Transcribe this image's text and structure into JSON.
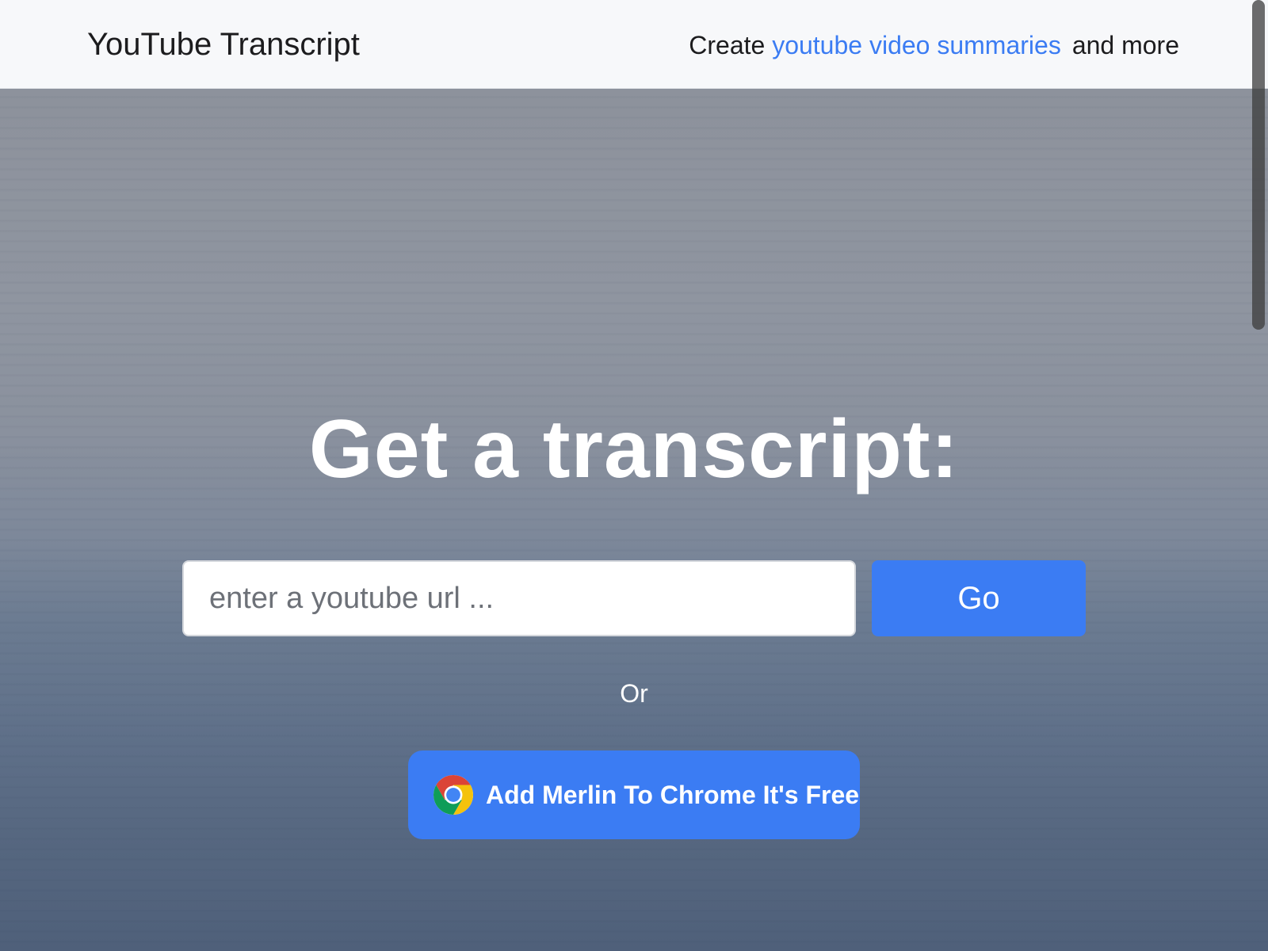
{
  "header": {
    "brand": "YouTube Transcript",
    "tagline_prefix": "Create ",
    "tagline_link": "youtube video summaries",
    "tagline_suffix": "and more"
  },
  "hero": {
    "title": "Get a transcript:",
    "url_placeholder": "enter a youtube url ...",
    "url_value": "",
    "go_label": "Go",
    "or_label": "Or",
    "chrome_button_label": "Add Merlin To Chrome It's Free",
    "chrome_icon": "chrome-icon"
  },
  "colors": {
    "accent": "#3b7cf3",
    "header_bg": "#f7f8fa",
    "text_dark": "#1c1c1e"
  }
}
